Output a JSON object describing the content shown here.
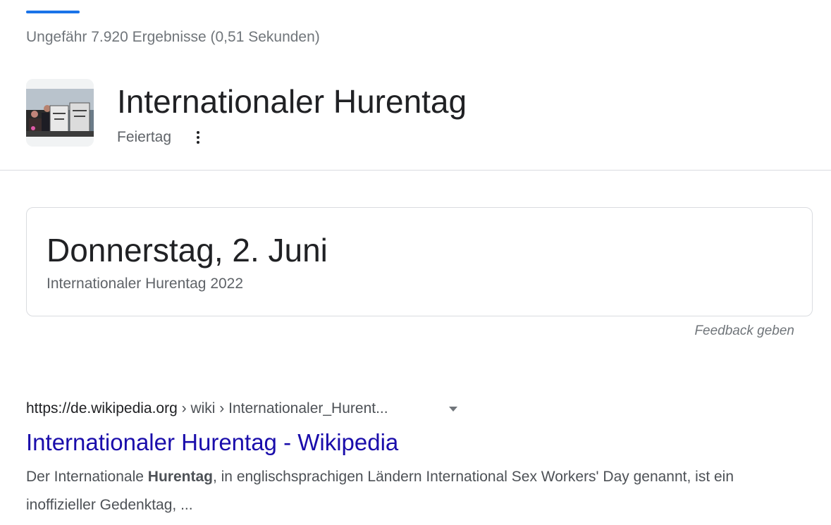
{
  "tabs": {
    "active_indicator_color": "#1a73e8"
  },
  "result_stats": "Ungefähr 7.920 Ergebnisse (0,51 Sekunden)",
  "knowledge_panel": {
    "title": "Internationaler Hurentag",
    "subtitle": "Feiertag",
    "more_icon": "vertical-dots-icon",
    "thumbnail_sign_text": "SEXWORK IS WORK"
  },
  "date_card": {
    "date": "Donnerstag, 2. Juni",
    "event": "Internationaler Hurentag 2022"
  },
  "feedback_label": "Feedback geben",
  "search_result": {
    "url_domain": "https://de.wikipedia.org",
    "url_path": " › wiki › Internationaler_Hurent...",
    "dropdown_icon": "caret-down-icon",
    "title": "Internationaler Hurentag - Wikipedia",
    "snippet_before": "Der Internationale ",
    "snippet_bold": "Hurentag",
    "snippet_after": ", in englischsprachigen Ländern International Sex Workers' Day genannt, ist ein inoffizieller Gedenktag, ..."
  },
  "colors": {
    "link": "#1a0dab",
    "divider": "#dadce0",
    "text_secondary": "#70757a"
  }
}
